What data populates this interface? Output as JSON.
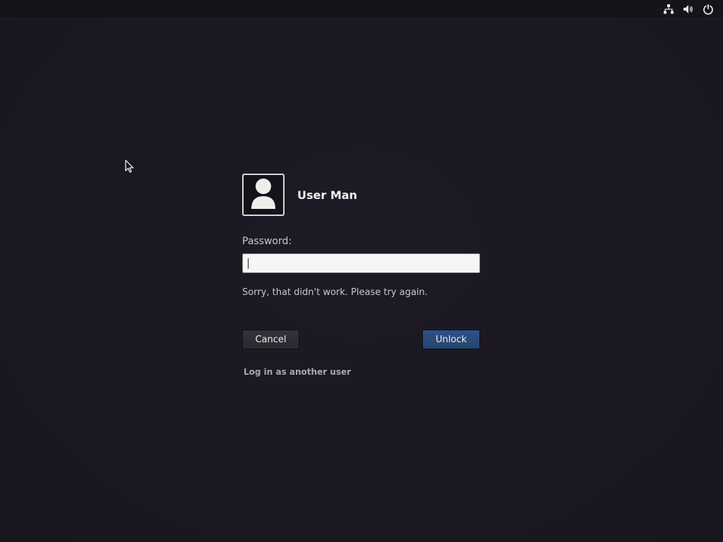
{
  "top_bar": {
    "icons": [
      "network-icon",
      "volume-icon",
      "power-icon"
    ]
  },
  "dialog": {
    "user_name": "User Man",
    "password_label": "Password:",
    "password_value": "",
    "error_message": "Sorry, that didn't work. Please try again.",
    "cancel_label": "Cancel",
    "unlock_label": "Unlock",
    "other_user_label": "Log in as another user"
  },
  "colors": {
    "background": "#1c1823",
    "top_bar": "#16141b",
    "accent_button": "#2f5286",
    "text": "#eeeeec"
  }
}
